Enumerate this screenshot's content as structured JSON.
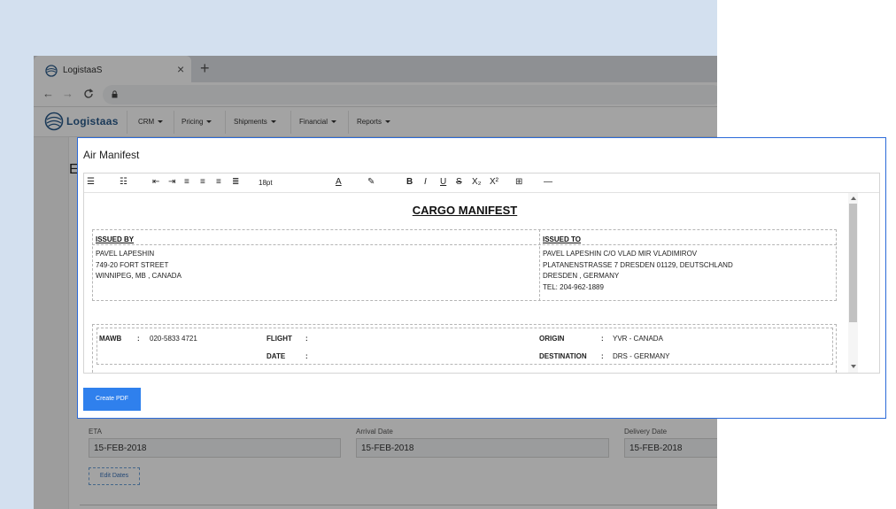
{
  "browser": {
    "tab_title": "LogistaaS",
    "tab_close": "×",
    "new_tab": "+"
  },
  "app": {
    "brand": "Logistaas",
    "nav": [
      "CRM",
      "Pricing",
      "Shipments",
      "Financial",
      "Reports"
    ]
  },
  "page": {
    "heading_letter": "E",
    "fields": [
      {
        "label": "ETA",
        "value": "15-FEB-2018"
      },
      {
        "label": "Arrival Date",
        "value": "15-FEB-2018"
      },
      {
        "label": "Delivery Date",
        "value": "15-FEB-2018"
      }
    ],
    "edit_dates_label": "Edit Dates"
  },
  "modal": {
    "title": "Air Manifest",
    "font_size": "18pt",
    "create_pdf_label": "Create PDF",
    "document": {
      "title": "CARGO MANIFEST",
      "issued_by": {
        "label": "ISSUED BY",
        "lines": [
          "PAVEL LAPESHIN",
          "749-20 FORT STREET",
          "WINNIPEG, MB , CANADA"
        ]
      },
      "issued_to": {
        "label": "ISSUED TO",
        "lines": [
          "PAVEL LAPESHIN C/O VLAD MIR VLADIMIROV",
          "PLATANENSTRASSE 7 DRESDEN 01129, DEUTSCHLAND",
          "DRESDEN , GERMANY",
          "TEL: 204-962-1889"
        ]
      },
      "mawb_label": "MAWB",
      "mawb_value": "020-5833 4721",
      "flight_label": "FLIGHT",
      "flight_value": "",
      "date_label": "DATE",
      "date_value": "",
      "origin_label": "ORIGIN",
      "origin_value": "YVR - CANADA",
      "destination_label": "DESTINATION",
      "destination_value": "DRS - GERMANY",
      "colon": ":"
    }
  }
}
